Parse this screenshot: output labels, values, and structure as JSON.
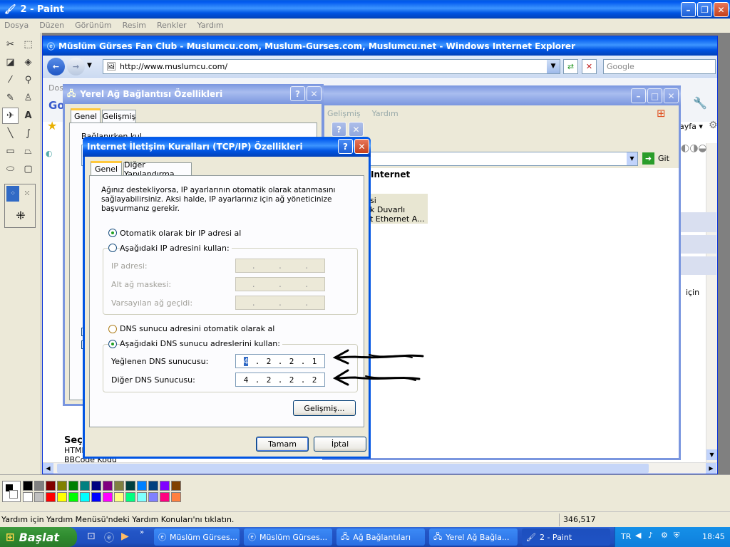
{
  "paint": {
    "title": "2 - Paint",
    "menu": [
      "Dosya",
      "Düzen",
      "Görünüm",
      "Resim",
      "Renkler",
      "Yardım"
    ],
    "status_text": "Yardım için Yardım Menüsü'ndeki Yardım Konuları'nı tıklatın.",
    "coords": "346,517",
    "palette": [
      "#000000",
      "#808080",
      "#800000",
      "#808000",
      "#008000",
      "#008080",
      "#000080",
      "#800080",
      "#808040",
      "#004040",
      "#0080ff",
      "#004080",
      "#8000ff",
      "#804000",
      "#ffffff",
      "#c0c0c0",
      "#ff0000",
      "#ffff00",
      "#00ff00",
      "#00ffff",
      "#0000ff",
      "#ff00ff",
      "#ffff80",
      "#00ff80",
      "#80ffff",
      "#8080ff",
      "#ff0080",
      "#ff8040"
    ]
  },
  "ie": {
    "title": "Müslüm Gürses Fan Club - Muslumcu.com, Muslum-Gurses.com, Muslumcu.net - Windows Internet Explorer",
    "url": "http://www.muslumcu.com/",
    "search_placeholder": "Google",
    "page_frag_1": "Seç",
    "page_frag_2": "HTML",
    "page_frag_3": "BBCode Kodu",
    "page_frag_4": "için",
    "page_frag_5": "ayfa ▾"
  },
  "net_window": {
    "menu_1": "Gelişmiş",
    "menu_2": "Yardım",
    "address_go": "Git",
    "header": "Internet",
    "list_1": "si",
    "list_2": "k Duvarlı",
    "list_3": "t Ethernet A..."
  },
  "lan_dialog": {
    "title": "Yerel Ağ Bağlantısı Özellikleri",
    "tab_general": "Genel",
    "tab_advanced": "Gelişmiş",
    "frag": "Bağlanırken kul"
  },
  "tcp_dialog": {
    "title": "Internet İletişim Kuralları (TCP/IP) Özellikleri",
    "tab_general": "Genel",
    "tab_alt": "Diğer Yapılandırma",
    "desc_1": "Ağınız destekliyorsa, IP ayarlarının otomatik olarak atanmasını",
    "desc_2": "sağlayabilirsiniz. Aksi halde, IP ayarlarınız için ağ yöneticinize",
    "desc_3": "başvurmanız gerekir.",
    "radio_auto_ip": "Otomatik olarak bir IP adresi al",
    "radio_manual_ip": "Aşağıdaki IP adresini kullan:",
    "ip_label": "IP adresi:",
    "mask_label": "Alt ağ maskesi:",
    "gateway_label": "Varsayılan ağ geçidi:",
    "radio_auto_dns": "DNS sunucu adresini otomatik olarak al",
    "radio_manual_dns": "Aşağıdaki DNS sunucu adreslerini kullan:",
    "pref_dns_label": "Yeğlenen DNS sunucusu:",
    "alt_dns_label": "Diğer DNS Sunucusu:",
    "pref_dns": [
      "4",
      "2",
      "2",
      "1"
    ],
    "alt_dns": [
      "4",
      "2",
      "2",
      "2"
    ],
    "advanced_btn": "Gelişmiş...",
    "ok_btn": "Tamam",
    "cancel_btn": "İptal"
  },
  "taskbar": {
    "start": "Başlat",
    "items": [
      "Müslüm Gürses...",
      "Müslüm Gürses...",
      "Ağ Bağlantıları",
      "Yerel Ağ Bağla...",
      "2 - Paint"
    ],
    "lang": "TR",
    "clock": "18:45"
  }
}
